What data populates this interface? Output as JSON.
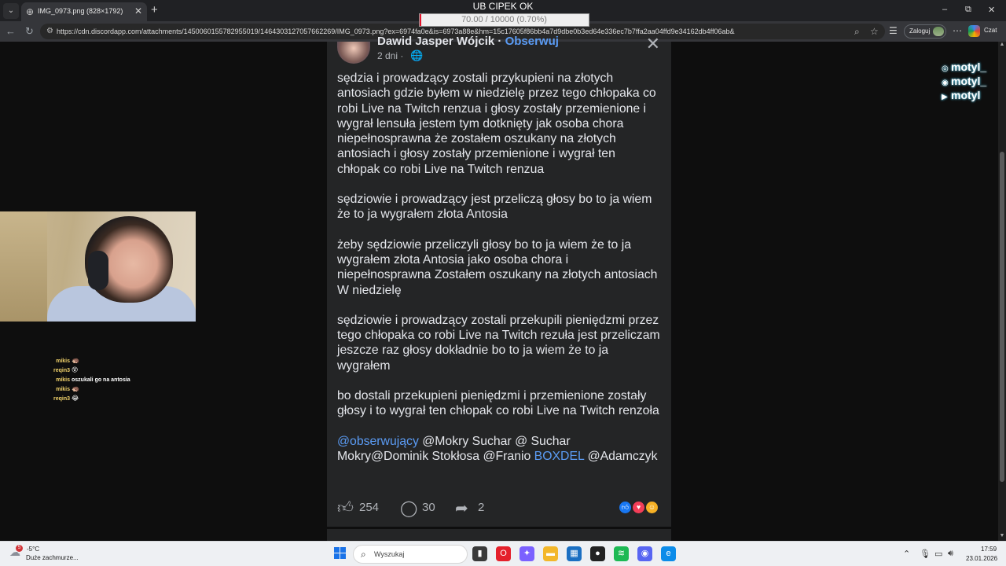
{
  "browser": {
    "tab_list_icon": "chevron-down-icon",
    "tab": {
      "title": "IMG_0973.png (828×1792)",
      "close": "✕"
    },
    "new_tab": "+",
    "window_controls": [
      "–",
      "⧉",
      "✕"
    ],
    "url": "https://cdn.discordapp.com/attachments/1450060155782955019/1464303127057662269/IMG_0973.png?ex=6974fa0e&is=6973a88e&hm=15c17605f86bb4a7d9dbe0b3ed64e336ec7b7ffa2aa04ffd9e34162db4ff06ab&",
    "login_label": "Zaloguj",
    "chat_label": "Czat"
  },
  "overlay": {
    "title": "UB CIPEK OK",
    "progress_text": "70.00 / 10000 (0.70%)",
    "progress_fraction": 0.007,
    "progress_color": "#e3152b"
  },
  "post": {
    "author": "Dawid Jasper Wójcik",
    "separator": " · ",
    "follow": "Obserwuj",
    "time": "2 dni ·",
    "globe_icon": "globe-icon",
    "close": "✕",
    "paragraphs": [
      "sędzia i prowadzący zostali przykupieni na złotych antosiach gdzie byłem w niedzielę przez tego chłopaka co robi Live na Twitch renzua i głosy zostały przemienione i wygrał lensuła jestem tym dotknięty jak osoba chora niepełnosprawna że zostałem oszukany na złotych antosiach i głosy zostały przemienione i wygrał ten chłopak co robi Live na Twitch renzua",
      "sędziowie i prowadzący jest przeliczą głosy bo to ja wiem że to ja wygrałem złota Antosia",
      "żeby sędziowie przeliczyli głosy bo to ja wiem że to ja wygrałem złota Antosia jako osoba chora i niepełnosprawna Zostałem oszukany na złotych antosiach W niedzielę",
      "sędziowie i prowadzący zostali przekupili pieniędzmi przez tego chłopaka co robi Live na Twitch rezuła jest przeliczam jeszcze raz głosy dokładnie bo to ja wiem że to ja wygrałem",
      "bo dostali przekupieni pieniędzmi i przemienione zostały głosy i to wygrał ten chłopak co robi Live na Twitch renzoła"
    ],
    "tags": {
      "mention1": "@obserwujący",
      "text1": " @Mokry Suchar @ Suchar Mokry@Dominik Stokłosa @Franio ",
      "mention2": "BOXDEL",
      "text2": " @Adamczyk"
    },
    "likes": "254",
    "comments": "30",
    "shares": "2",
    "reaction_icons": [
      "like-reaction-icon",
      "love-reaction-icon",
      "haha-reaction-icon"
    ],
    "reaction_colors": [
      "#1877f2",
      "#f33e58",
      "#f7b125"
    ]
  },
  "socials": [
    {
      "icon": "instagram-icon",
      "handle": "motyl_"
    },
    {
      "icon": "discord-icon",
      "handle": "motyl_"
    },
    {
      "icon": "youtube-icon",
      "handle": "motyl"
    }
  ],
  "chat": [
    {
      "user": "mikis",
      "message": "",
      "emote": "🦔"
    },
    {
      "user": "reqin3",
      "message": "",
      "emote": "😵"
    },
    {
      "user": "mikis",
      "message": "oszukali go na antosia",
      "emote": ""
    },
    {
      "user": "mikis",
      "message": "",
      "emote": "🦔"
    },
    {
      "user": "reqin3",
      "message": "",
      "emote": "😂"
    }
  ],
  "taskbar": {
    "weather_badge": "5",
    "temperature": "-5°C",
    "weather_desc": "Duże zachmurze...",
    "search_placeholder": "Wyszukaj",
    "apps": [
      {
        "name": "file-explorer-app",
        "glyph": "▮",
        "color": "#3a3a3a"
      },
      {
        "name": "opera-app",
        "glyph": "O",
        "color": "#e4202b"
      },
      {
        "name": "copilot-app",
        "glyph": "✦",
        "color": "#7b61ff"
      },
      {
        "name": "folder-app",
        "glyph": "▬",
        "color": "#f3b72a"
      },
      {
        "name": "store-app",
        "glyph": "▦",
        "color": "#1b6fc2"
      },
      {
        "name": "obs-app",
        "glyph": "●",
        "color": "#222222"
      },
      {
        "name": "spotify-app",
        "glyph": "≋",
        "color": "#1db954"
      },
      {
        "name": "discord-app",
        "glyph": "◉",
        "color": "#5865f2"
      },
      {
        "name": "edge-app",
        "glyph": "e",
        "color": "#0c8ce9"
      }
    ],
    "time": "17:59",
    "date": "23.01.2026"
  }
}
